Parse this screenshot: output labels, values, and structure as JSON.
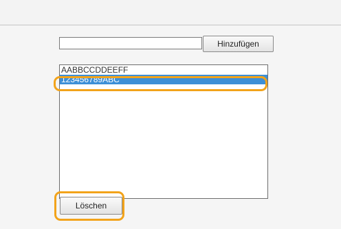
{
  "form": {
    "input_value": "",
    "add_button_label": "Hinzufügen"
  },
  "list": {
    "items": [
      {
        "label": "AABBCCDDEEFF",
        "selected": false
      },
      {
        "label": "123456789ABC",
        "selected": true
      }
    ]
  },
  "actions": {
    "delete_button_label": "Löschen"
  },
  "colors": {
    "highlight": "#f2a31a",
    "selection": "#3d8fd6"
  }
}
